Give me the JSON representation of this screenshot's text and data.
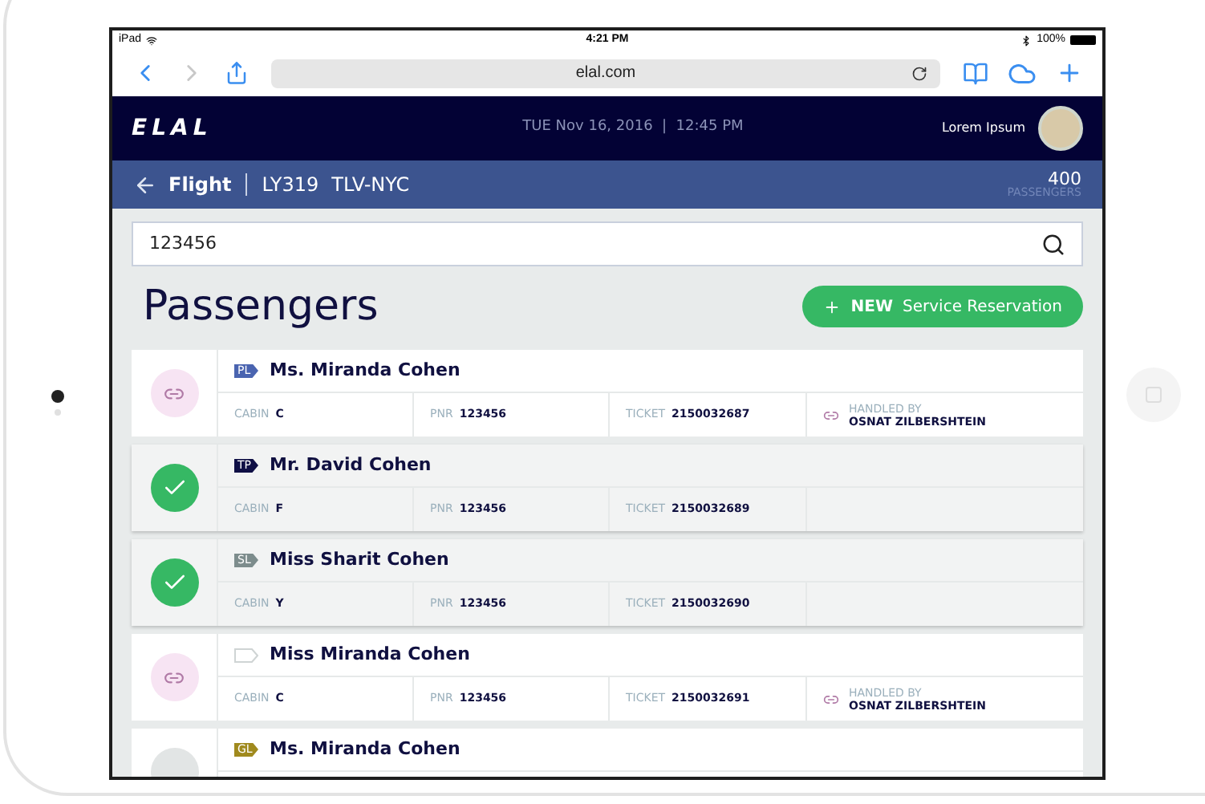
{
  "status_bar": {
    "device": "iPad",
    "time": "4:21 PM",
    "battery": "100%"
  },
  "browser": {
    "url": "elal.com"
  },
  "header": {
    "logo": "ELAL",
    "datetime": "TUE Nov 16, 2016  |  12:45 PM",
    "user": "Lorem Ipsum"
  },
  "flight_bar": {
    "title": "Flight",
    "flight": "LY319",
    "route": "TLV-NYC",
    "count": "400",
    "count_label": "PASSENGERS"
  },
  "search": {
    "value": "123456"
  },
  "page_title": "Passengers",
  "new_button": {
    "bold": "NEW",
    "label": "Service Reservation"
  },
  "passengers": [
    {
      "kind": "linked",
      "tag": "PL",
      "color": "#4a64b0",
      "name": "Ms. Miranda Cohen",
      "cabin_label": "CABIN",
      "cabin": "C",
      "pnr_label": "PNR",
      "pnr": "123456",
      "ticket_label": "TICKET",
      "ticket": "2150032687",
      "handled_label": "HANDLED BY",
      "handled_by": "OSNAT ZILBERSHTEIN"
    },
    {
      "kind": "done",
      "tag": "TP",
      "color": "#0f0f45",
      "name": "Mr. David Cohen",
      "cabin_label": "CABIN",
      "cabin": "F",
      "pnr_label": "PNR",
      "pnr": "123456",
      "ticket_label": "TICKET",
      "ticket": "2150032689"
    },
    {
      "kind": "done",
      "tag": "SL",
      "color": "#7d8c8c",
      "name": "Miss Sharit Cohen",
      "cabin_label": "CABIN",
      "cabin": "Y",
      "pnr_label": "PNR",
      "pnr": "123456",
      "ticket_label": "TICKET",
      "ticket": "2150032690"
    },
    {
      "kind": "linked",
      "name": "Miss Miranda Cohen",
      "cabin_label": "CABIN",
      "cabin": "C",
      "pnr_label": "PNR",
      "pnr": "123456",
      "ticket_label": "TICKET",
      "ticket": "2150032691",
      "handled_label": "HANDLED BY",
      "handled_by": "OSNAT ZILBERSHTEIN"
    },
    {
      "kind": "pending",
      "tag": "GL",
      "color": "#a08a1e",
      "name": "Ms. Miranda Cohen"
    }
  ]
}
